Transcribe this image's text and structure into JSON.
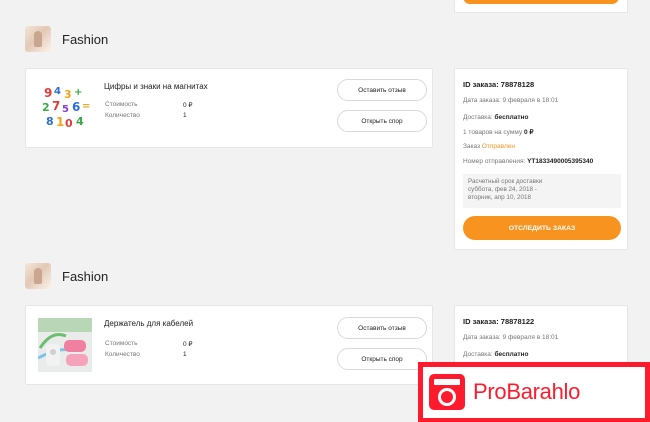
{
  "orders": [
    {
      "store_name": "Fashion",
      "product_title": "Цифры и знаки на магнитах",
      "cost_label": "Стоимость",
      "cost_value": "0 ₽",
      "qty_label": "Количество",
      "qty_value": "1",
      "review_button": "Оставить отзыв",
      "dispute_button": "Открыть спор",
      "order_id_label": "ID заказа:",
      "order_id": "78878128",
      "order_date": "Дата заказа: 9 февраля в 18:01",
      "delivery_label": "Доставка:",
      "delivery_value": "бесплатно",
      "items_sum_label": "1 товаров на сумму",
      "items_sum_value": "0 ₽",
      "status_label": "Заказ",
      "status_value": "Отправлен",
      "tracking_label": "Номер отправления:",
      "tracking_value": "YT1833490005395340",
      "eta_title": "Расчетный срок доставки",
      "eta_from": "суббота, фев 24, 2018 -",
      "eta_to": "вторник, апр 10, 2018",
      "track_button": "ОТСЛЕДИТЬ ЗАКАЗ"
    },
    {
      "store_name": "Fashion",
      "product_title": "Держатель для кабелей",
      "cost_label": "Стоимость",
      "cost_value": "0 ₽",
      "qty_label": "Количество",
      "qty_value": "1",
      "review_button": "Оставить отзыв",
      "dispute_button": "Открыть спор",
      "order_id_label": "ID заказа:",
      "order_id": "78878122",
      "order_date": "Дата заказа: 9 февраля в 18:01",
      "delivery_label": "Доставка:",
      "delivery_value": "бесплатно"
    }
  ],
  "watermark": {
    "text": "ProBarahlo"
  },
  "colors": {
    "accent": "#f7931e",
    "watermark_red": "#ff1b2d",
    "background": "#f2f2f2"
  }
}
